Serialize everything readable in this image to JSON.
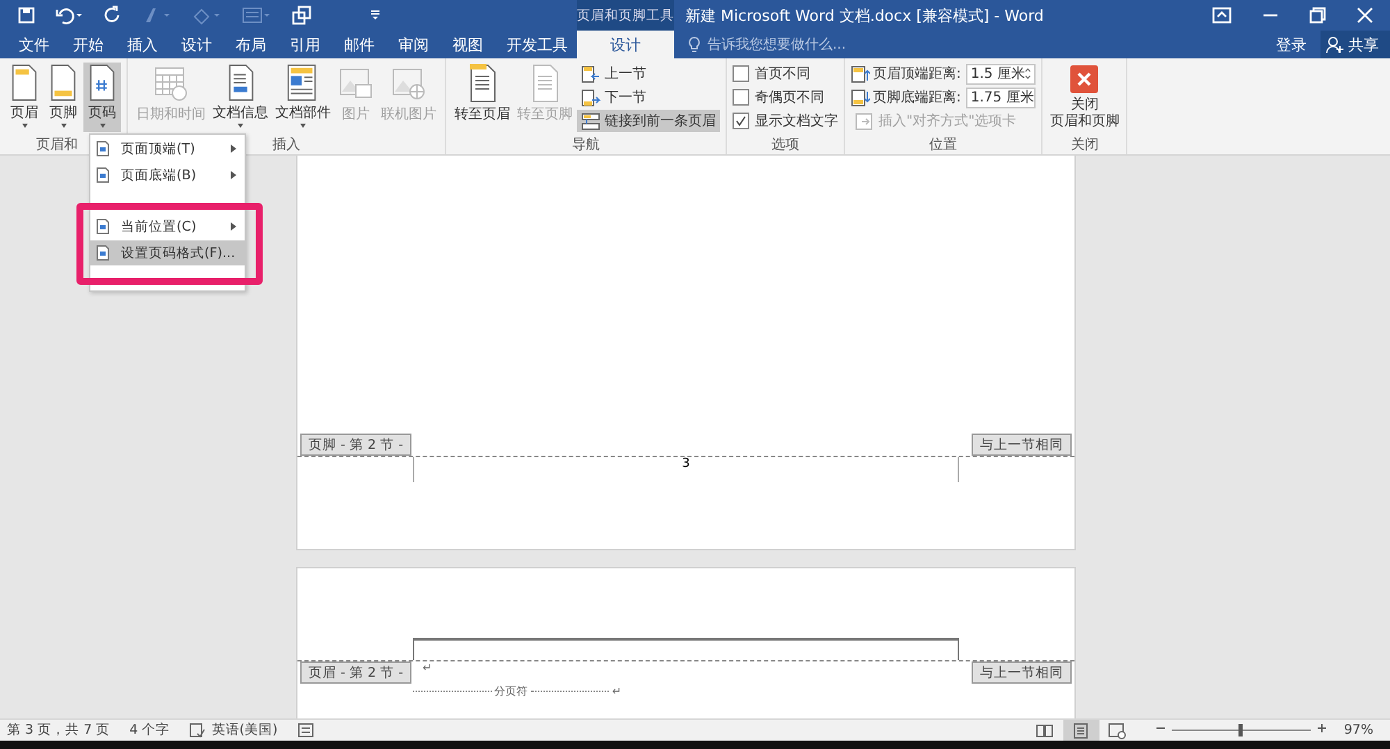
{
  "window": {
    "title": "新建 Microsoft Word 文档.docx [兼容模式] - Word",
    "context_tool": "页眉和页脚工具"
  },
  "tabs": [
    {
      "label": "文件",
      "selected": false
    },
    {
      "label": "开始",
      "selected": false
    },
    {
      "label": "插入",
      "selected": false
    },
    {
      "label": "设计",
      "selected": false
    },
    {
      "label": "布局",
      "selected": false
    },
    {
      "label": "引用",
      "selected": false
    },
    {
      "label": "邮件",
      "selected": false
    },
    {
      "label": "审阅",
      "selected": false
    },
    {
      "label": "视图",
      "selected": false
    },
    {
      "label": "开发工具",
      "selected": false
    },
    {
      "label": "设计",
      "selected": true
    }
  ],
  "tell_me": {
    "placeholder": "告诉我您想要做什么..."
  },
  "account": {
    "sign_in": "登录",
    "share": "共享"
  },
  "ribbon_groups": [
    {
      "label": "页眉和",
      "items": [
        {
          "kind": "large",
          "label": "页眉",
          "dropdown": true,
          "disabled": false,
          "pressed": false
        },
        {
          "kind": "large",
          "label": "页脚",
          "dropdown": true,
          "disabled": false,
          "pressed": false
        },
        {
          "kind": "large",
          "label": "页码",
          "dropdown": true,
          "disabled": false,
          "pressed": true
        }
      ]
    },
    {
      "label": "插入",
      "items": [
        {
          "kind": "large",
          "label": "日期和时间",
          "dropdown": false,
          "disabled": true,
          "pressed": false
        },
        {
          "kind": "large",
          "label": "文档信息",
          "dropdown": true,
          "disabled": false,
          "pressed": false
        },
        {
          "kind": "large",
          "label": "文档部件",
          "dropdown": true,
          "disabled": false,
          "pressed": false
        },
        {
          "kind": "large",
          "label": "图片",
          "dropdown": false,
          "disabled": true,
          "pressed": false
        },
        {
          "kind": "large",
          "label": "联机图片",
          "dropdown": false,
          "disabled": true,
          "pressed": false
        }
      ]
    },
    {
      "label": "导航",
      "items": [
        {
          "kind": "large",
          "label": "转至页眉",
          "dropdown": false,
          "disabled": false,
          "pressed": false
        },
        {
          "kind": "large",
          "label": "转至页脚",
          "dropdown": false,
          "disabled": true,
          "pressed": false
        },
        {
          "kind": "small",
          "label": "上一节",
          "disabled": false,
          "pressed": false
        },
        {
          "kind": "small",
          "label": "下一节",
          "disabled": false,
          "pressed": false
        },
        {
          "kind": "small",
          "label": "链接到前一条页眉",
          "disabled": false,
          "pressed": true
        }
      ]
    },
    {
      "label": "选项",
      "items": [
        {
          "kind": "checkbox",
          "label": "首页不同",
          "checked": false
        },
        {
          "kind": "checkbox",
          "label": "奇偶页不同",
          "checked": false
        },
        {
          "kind": "checkbox",
          "label": "显示文档文字",
          "checked": true
        }
      ]
    },
    {
      "label": "位置",
      "items": [
        {
          "kind": "spin",
          "label": "页眉顶端距离:",
          "value": "1.5 厘米"
        },
        {
          "kind": "spin",
          "label": "页脚底端距离:",
          "value": "1.75 厘米"
        },
        {
          "kind": "small",
          "label": "插入\"对齐方式\"选项卡",
          "disabled": true,
          "pressed": false
        }
      ]
    },
    {
      "label": "关闭",
      "items": [
        {
          "kind": "close",
          "lines": [
            "关闭",
            "页眉和页脚"
          ]
        }
      ]
    }
  ],
  "menu": {
    "items": [
      {
        "label": "页面顶端(T)",
        "submenu": true,
        "selected": false
      },
      {
        "label": "页面底端(B)",
        "submenu": true,
        "selected": false
      },
      {
        "kind": "gap"
      },
      {
        "label": "当前位置(C)",
        "submenu": true,
        "selected": false
      },
      {
        "label": "设置页码格式(F)...",
        "submenu": false,
        "selected": true
      }
    ]
  },
  "pages": [
    {
      "kind": "footer",
      "tag": "页脚 - 第 2 节 -",
      "same_as_previous": "与上一节相同",
      "page_number": "3"
    },
    {
      "kind": "header",
      "tag": "页眉 - 第 2 节 -",
      "same_as_previous": "与上一节相同",
      "paragraph_mark": "↵",
      "page_break": "分页符",
      "break_mark": "↵"
    }
  ],
  "status_bar": {
    "page": "第 3 页，共 7 页",
    "words": "4 个字",
    "language": "英语(美国)",
    "views": [
      {
        "kind": "read",
        "selected": false
      },
      {
        "kind": "print",
        "selected": true
      },
      {
        "kind": "web",
        "selected": false
      }
    ],
    "zoom": {
      "level": 0.48,
      "reading": "97%"
    }
  }
}
